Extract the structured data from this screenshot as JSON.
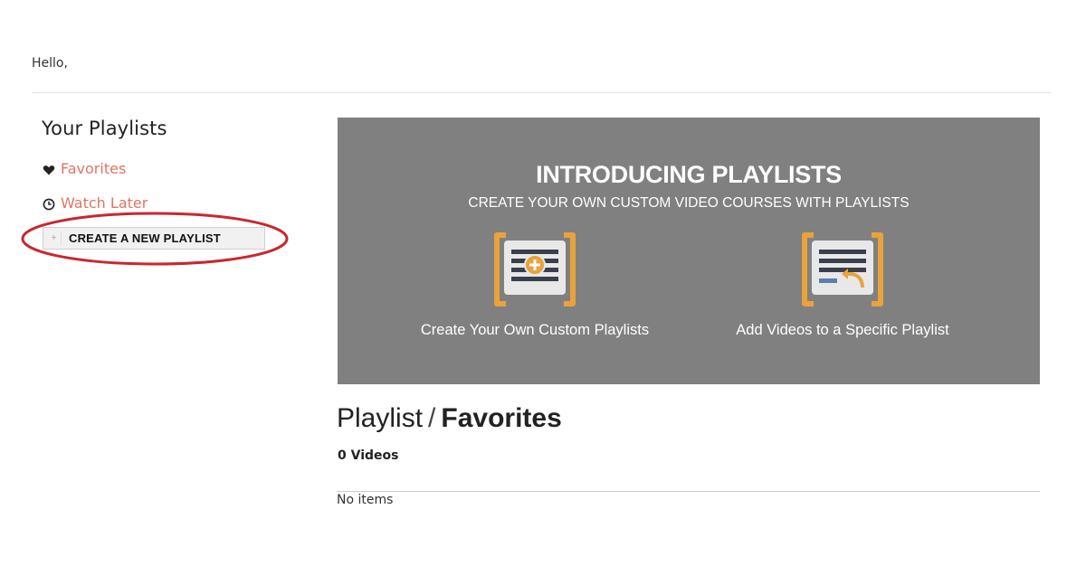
{
  "greeting": "Hello,",
  "sidebar": {
    "title": "Your Playlists",
    "links": [
      {
        "label": "Favorites",
        "icon": "heart-icon"
      },
      {
        "label": "Watch Later",
        "icon": "clock-icon"
      }
    ],
    "create_button_label": "CREATE A NEW PLAYLIST",
    "link_color": "#e07565"
  },
  "banner": {
    "title": "INTRODUCING PLAYLISTS",
    "subtitle": "CREATE YOUR OWN CUSTOM VIDEO COURSES WITH PLAYLISTS",
    "features": [
      {
        "label": "Create Your Own Custom Playlists",
        "icon": "add-to-list-icon"
      },
      {
        "label": "Add Videos to a Specific Playlist",
        "icon": "return-to-list-icon"
      }
    ],
    "background_color": "#808080",
    "accent_color": "#e8a33d"
  },
  "playlist": {
    "heading_prefix": "Playlist",
    "heading_separator": "/",
    "heading_name": "Favorites",
    "video_count": "0 Videos",
    "empty_message": "No items"
  },
  "annotation_color": "#c8282e"
}
